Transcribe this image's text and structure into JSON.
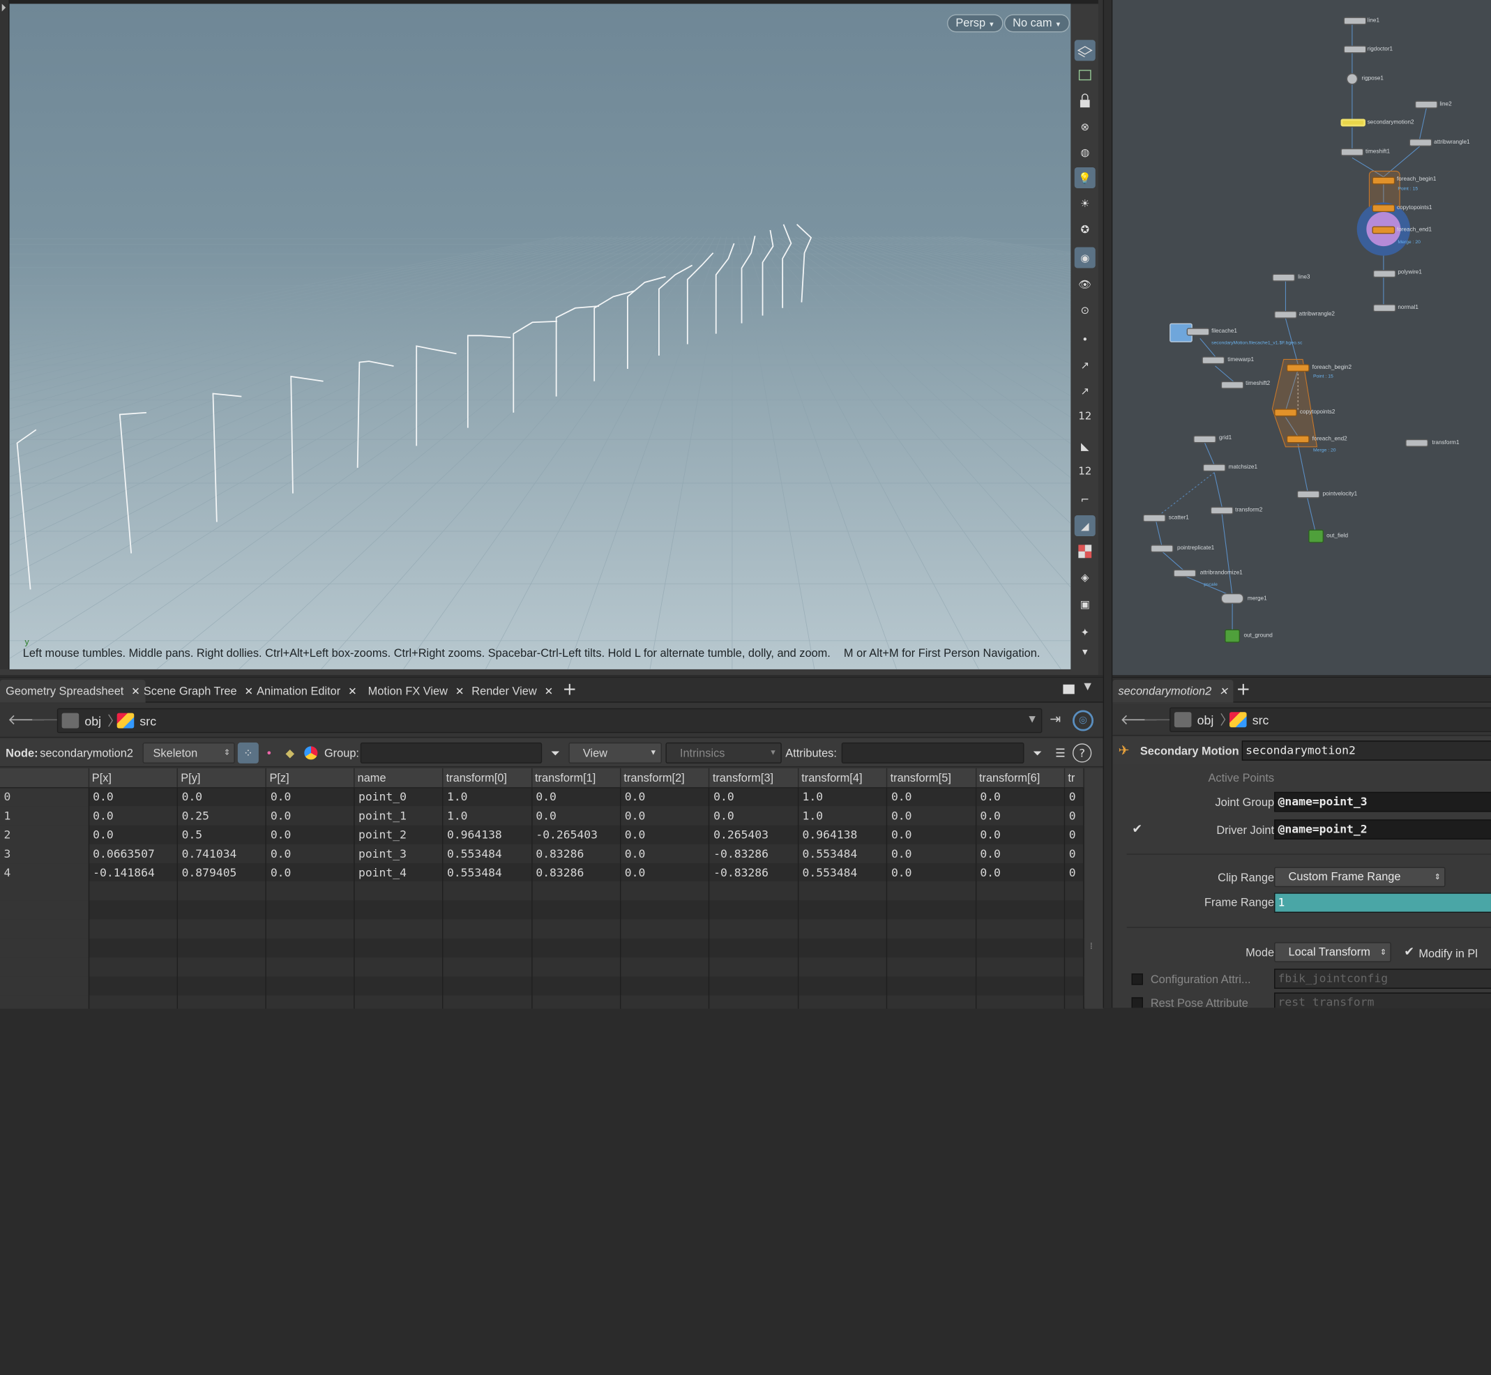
{
  "viewport": {
    "persp_label": "Persp",
    "cam_label": "No cam",
    "axis_label": "y",
    "hint_text": "Left mouse tumbles. Middle pans. Right dollies. Ctrl+Alt+Left box-zooms. Ctrl+Right zooms. Spacebar-Ctrl-Left tilts. Hold L for alternate tumble, dolly, and zoom.",
    "hint_text2": "M or Alt+M for First Person Navigation.",
    "toolbar_badge_1": "12",
    "toolbar_badge_2": "12"
  },
  "bottom_tabs": [
    {
      "label": "Geometry Spreadsheet"
    },
    {
      "label": "Scene Graph Tree"
    },
    {
      "label": "Animation Editor"
    },
    {
      "label": "Motion FX View"
    },
    {
      "label": "Render View"
    }
  ],
  "path": {
    "obj": "obj",
    "src": "src"
  },
  "spreadsheet": {
    "node_label": "Node:",
    "node_name": "secondarymotion2",
    "mode": "Skeleton",
    "group_label": "Group:",
    "group_value": "",
    "view_label": "View",
    "intrinsics_label": "Intrinsics",
    "attributes_label": "Attributes:",
    "attributes_value": "",
    "columns": [
      "",
      "P[x]",
      "P[y]",
      "P[z]",
      "name",
      "transform[0]",
      "transform[1]",
      "transform[2]",
      "transform[3]",
      "transform[4]",
      "transform[5]",
      "transform[6]",
      "tr"
    ],
    "rows": [
      [
        "0",
        "0.0",
        "0.0",
        "0.0",
        "point_0",
        "1.0",
        "0.0",
        "0.0",
        "0.0",
        "1.0",
        "0.0",
        "0.0",
        "0"
      ],
      [
        "1",
        "0.0",
        "0.25",
        "0.0",
        "point_1",
        "1.0",
        "0.0",
        "0.0",
        "0.0",
        "1.0",
        "0.0",
        "0.0",
        "0"
      ],
      [
        "2",
        "0.0",
        "0.5",
        "0.0",
        "point_2",
        "0.964138",
        "-0.265403",
        "0.0",
        "0.265403",
        "0.964138",
        "0.0",
        "0.0",
        "0"
      ],
      [
        "3",
        "0.0663507",
        "0.741034",
        "0.0",
        "point_3",
        "0.553484",
        "0.83286",
        "0.0",
        "-0.83286",
        "0.553484",
        "0.0",
        "0.0",
        "0"
      ],
      [
        "4",
        "-0.141864",
        "0.879405",
        "0.0",
        "point_4",
        "0.553484",
        "0.83286",
        "0.0",
        "-0.83286",
        "0.553484",
        "0.0",
        "0.0",
        "0"
      ]
    ]
  },
  "network": {
    "nodes": [
      {
        "label": "line1",
        "color": "gray"
      },
      {
        "label": "rigdoctor1",
        "color": "gray"
      },
      {
        "label": "rigpose1",
        "color": "gray"
      },
      {
        "label": "secondarymotion2",
        "color": "yellow"
      },
      {
        "label": "line2",
        "color": "gray"
      },
      {
        "label": "attribwrangle1",
        "color": "gray"
      },
      {
        "label": "timeshift1",
        "color": "gray"
      },
      {
        "label": "foreach_begin1",
        "sub": "Point : 15",
        "color": "orange"
      },
      {
        "label": "copytopoints1",
        "color": "orange"
      },
      {
        "label": "foreach_end1",
        "sub": "Merge : 20",
        "color": "orange"
      },
      {
        "label": "polywire1",
        "color": "gray"
      },
      {
        "label": "normal1",
        "color": "gray"
      },
      {
        "label": "line3",
        "color": "gray"
      },
      {
        "label": "attribwrangle2",
        "color": "gray"
      },
      {
        "label": "filecache1",
        "sub": "secondaryMotion.filecache1_v1.$F.bgeo.sc",
        "color": "blue"
      },
      {
        "label": "timewarp1",
        "color": "gray"
      },
      {
        "label": "foreach_begin2",
        "sub": "Point : 15",
        "color": "orange"
      },
      {
        "label": "timeshift2",
        "color": "gray"
      },
      {
        "label": "copytopoints2",
        "color": "orange"
      },
      {
        "label": "foreach_end2",
        "sub": "Merge : 20",
        "color": "orange"
      },
      {
        "label": "grid1",
        "color": "gray"
      },
      {
        "label": "matchsize1",
        "color": "gray"
      },
      {
        "label": "transform1",
        "color": "gray"
      },
      {
        "label": "pointvelocity1",
        "color": "gray"
      },
      {
        "label": "transform2",
        "color": "gray"
      },
      {
        "label": "scatter1",
        "color": "gray"
      },
      {
        "label": "out_field",
        "color": "green"
      },
      {
        "label": "pointreplicate1",
        "color": "gray"
      },
      {
        "label": "attribrandomize1",
        "sub": "pscale",
        "color": "gray"
      },
      {
        "label": "merge1",
        "color": "gray"
      },
      {
        "label": "out_ground",
        "color": "green"
      }
    ]
  },
  "params": {
    "tab_label": "secondarymotion2",
    "node_type": "Secondary Motion",
    "node_name": "secondarymotion2",
    "active_points_label": "Active Points",
    "joint_group_label": "Joint Group",
    "joint_group_value": "@name=point_3",
    "driver_joint_label": "Driver Joint",
    "driver_joint_value": "@name=point_2",
    "clip_range_label": "Clip Range",
    "clip_range_value": "Custom Frame Range",
    "frame_range_label": "Frame Range",
    "frame_range_value": "1",
    "mode_label": "Mode",
    "mode_value": "Local Transform",
    "modify_label": "Modify in Pl",
    "config_label": "Configuration Attri...",
    "config_value": "fbik_jointconfig",
    "rest_label": "Rest Pose Attribute",
    "rest_value": "rest_transform"
  }
}
